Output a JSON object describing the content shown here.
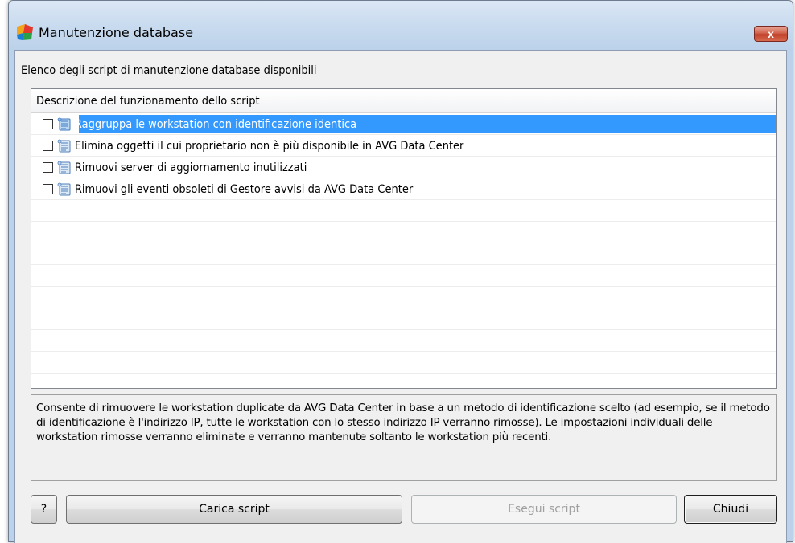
{
  "window": {
    "title": "Manutenzione database",
    "close_glyph": "x"
  },
  "list": {
    "caption": "Elenco degli script di manutenzione database disponibili",
    "column_header": "Descrizione del funzionamento dello script",
    "items": [
      {
        "label": "Raggruppa le workstation con identificazione identica",
        "checked": false,
        "selected": true
      },
      {
        "label": "Elimina oggetti il cui proprietario non è più disponibile in AVG Data Center",
        "checked": false,
        "selected": false
      },
      {
        "label": "Rimuovi server di aggiornamento inutilizzati",
        "checked": false,
        "selected": false
      },
      {
        "label": "Rimuovi gli eventi obsoleti di Gestore avvisi da AVG Data Center",
        "checked": false,
        "selected": false
      }
    ]
  },
  "description": "Consente di rimuovere le workstation duplicate da AVG Data Center in base a un metodo di identificazione scelto (ad esempio, se il metodo di identificazione è l'indirizzo IP, tutte le workstation con lo stesso indirizzo IP verranno rimosse). Le impostazioni individuali delle workstation rimosse verranno eliminate e verranno mantenute soltanto le workstation più recenti.",
  "buttons": {
    "help": "?",
    "load": "Carica script",
    "run": "Esegui script",
    "close": "Chiudi"
  },
  "colors": {
    "selection": "#3399ff",
    "dialog_bg": "#f0f0f0"
  },
  "icons": {
    "app": "avg-logo-icon",
    "item": "script-scroll-icon",
    "close": "close-icon"
  }
}
